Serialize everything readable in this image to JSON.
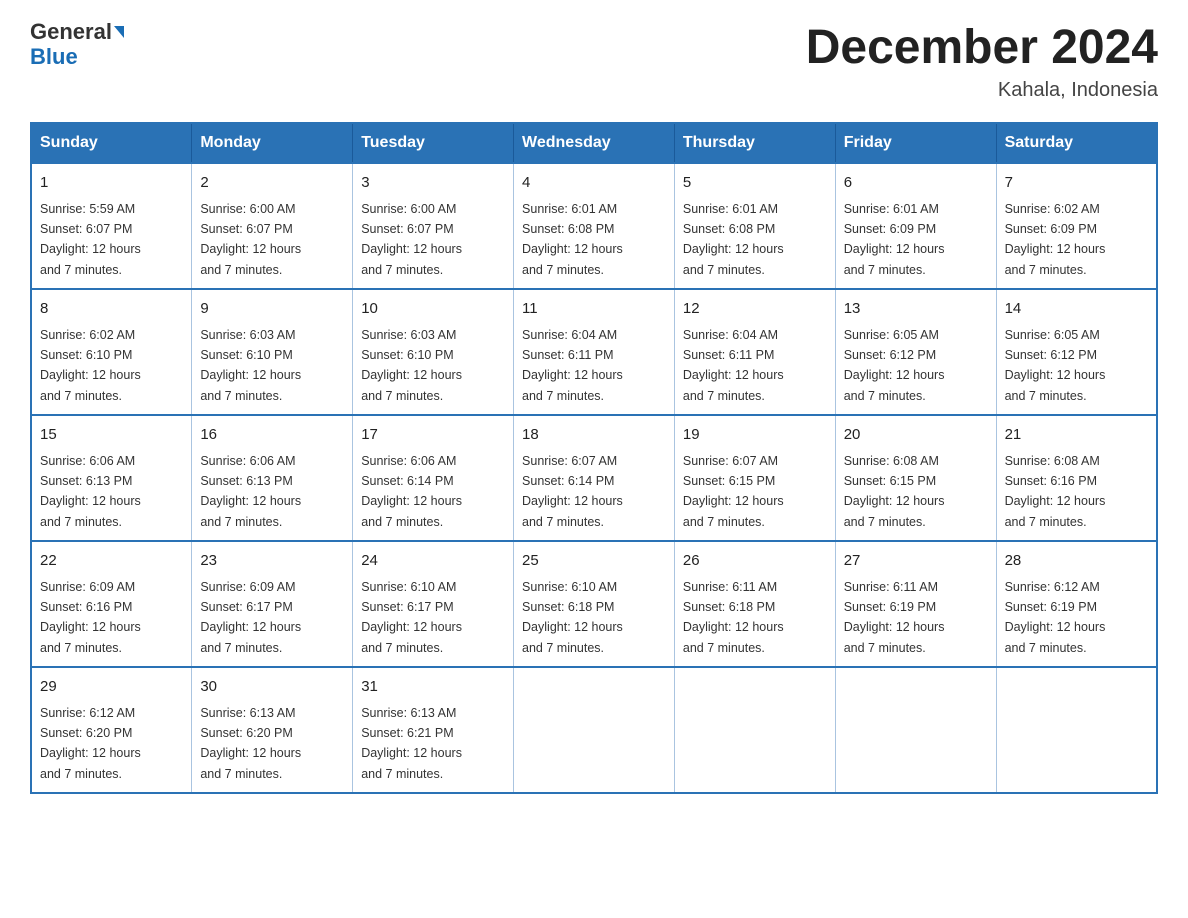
{
  "header": {
    "logo_line1": "General",
    "logo_line2": "Blue",
    "month_title": "December 2024",
    "location": "Kahala, Indonesia"
  },
  "days_of_week": [
    "Sunday",
    "Monday",
    "Tuesday",
    "Wednesday",
    "Thursday",
    "Friday",
    "Saturday"
  ],
  "weeks": [
    [
      {
        "day": "1",
        "sunrise": "5:59 AM",
        "sunset": "6:07 PM",
        "daylight": "12 hours and 7 minutes."
      },
      {
        "day": "2",
        "sunrise": "6:00 AM",
        "sunset": "6:07 PM",
        "daylight": "12 hours and 7 minutes."
      },
      {
        "day": "3",
        "sunrise": "6:00 AM",
        "sunset": "6:07 PM",
        "daylight": "12 hours and 7 minutes."
      },
      {
        "day": "4",
        "sunrise": "6:01 AM",
        "sunset": "6:08 PM",
        "daylight": "12 hours and 7 minutes."
      },
      {
        "day": "5",
        "sunrise": "6:01 AM",
        "sunset": "6:08 PM",
        "daylight": "12 hours and 7 minutes."
      },
      {
        "day": "6",
        "sunrise": "6:01 AM",
        "sunset": "6:09 PM",
        "daylight": "12 hours and 7 minutes."
      },
      {
        "day": "7",
        "sunrise": "6:02 AM",
        "sunset": "6:09 PM",
        "daylight": "12 hours and 7 minutes."
      }
    ],
    [
      {
        "day": "8",
        "sunrise": "6:02 AM",
        "sunset": "6:10 PM",
        "daylight": "12 hours and 7 minutes."
      },
      {
        "day": "9",
        "sunrise": "6:03 AM",
        "sunset": "6:10 PM",
        "daylight": "12 hours and 7 minutes."
      },
      {
        "day": "10",
        "sunrise": "6:03 AM",
        "sunset": "6:10 PM",
        "daylight": "12 hours and 7 minutes."
      },
      {
        "day": "11",
        "sunrise": "6:04 AM",
        "sunset": "6:11 PM",
        "daylight": "12 hours and 7 minutes."
      },
      {
        "day": "12",
        "sunrise": "6:04 AM",
        "sunset": "6:11 PM",
        "daylight": "12 hours and 7 minutes."
      },
      {
        "day": "13",
        "sunrise": "6:05 AM",
        "sunset": "6:12 PM",
        "daylight": "12 hours and 7 minutes."
      },
      {
        "day": "14",
        "sunrise": "6:05 AM",
        "sunset": "6:12 PM",
        "daylight": "12 hours and 7 minutes."
      }
    ],
    [
      {
        "day": "15",
        "sunrise": "6:06 AM",
        "sunset": "6:13 PM",
        "daylight": "12 hours and 7 minutes."
      },
      {
        "day": "16",
        "sunrise": "6:06 AM",
        "sunset": "6:13 PM",
        "daylight": "12 hours and 7 minutes."
      },
      {
        "day": "17",
        "sunrise": "6:06 AM",
        "sunset": "6:14 PM",
        "daylight": "12 hours and 7 minutes."
      },
      {
        "day": "18",
        "sunrise": "6:07 AM",
        "sunset": "6:14 PM",
        "daylight": "12 hours and 7 minutes."
      },
      {
        "day": "19",
        "sunrise": "6:07 AM",
        "sunset": "6:15 PM",
        "daylight": "12 hours and 7 minutes."
      },
      {
        "day": "20",
        "sunrise": "6:08 AM",
        "sunset": "6:15 PM",
        "daylight": "12 hours and 7 minutes."
      },
      {
        "day": "21",
        "sunrise": "6:08 AM",
        "sunset": "6:16 PM",
        "daylight": "12 hours and 7 minutes."
      }
    ],
    [
      {
        "day": "22",
        "sunrise": "6:09 AM",
        "sunset": "6:16 PM",
        "daylight": "12 hours and 7 minutes."
      },
      {
        "day": "23",
        "sunrise": "6:09 AM",
        "sunset": "6:17 PM",
        "daylight": "12 hours and 7 minutes."
      },
      {
        "day": "24",
        "sunrise": "6:10 AM",
        "sunset": "6:17 PM",
        "daylight": "12 hours and 7 minutes."
      },
      {
        "day": "25",
        "sunrise": "6:10 AM",
        "sunset": "6:18 PM",
        "daylight": "12 hours and 7 minutes."
      },
      {
        "day": "26",
        "sunrise": "6:11 AM",
        "sunset": "6:18 PM",
        "daylight": "12 hours and 7 minutes."
      },
      {
        "day": "27",
        "sunrise": "6:11 AM",
        "sunset": "6:19 PM",
        "daylight": "12 hours and 7 minutes."
      },
      {
        "day": "28",
        "sunrise": "6:12 AM",
        "sunset": "6:19 PM",
        "daylight": "12 hours and 7 minutes."
      }
    ],
    [
      {
        "day": "29",
        "sunrise": "6:12 AM",
        "sunset": "6:20 PM",
        "daylight": "12 hours and 7 minutes."
      },
      {
        "day": "30",
        "sunrise": "6:13 AM",
        "sunset": "6:20 PM",
        "daylight": "12 hours and 7 minutes."
      },
      {
        "day": "31",
        "sunrise": "6:13 AM",
        "sunset": "6:21 PM",
        "daylight": "12 hours and 7 minutes."
      },
      null,
      null,
      null,
      null
    ]
  ],
  "labels": {
    "sunrise": "Sunrise:",
    "sunset": "Sunset:",
    "daylight": "Daylight:"
  }
}
